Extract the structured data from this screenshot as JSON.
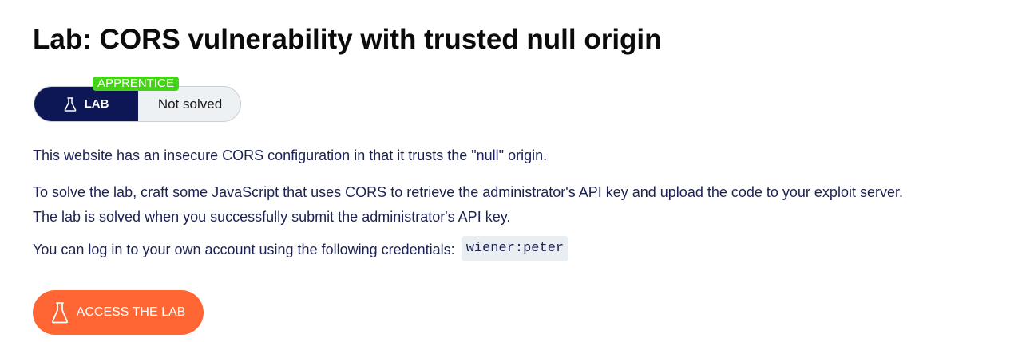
{
  "lab": {
    "title": "Lab: CORS vulnerability with trusted null origin",
    "level": "APPRENTICE",
    "badge_label": "LAB",
    "status": "Not solved",
    "description": {
      "line1": "This website has an insecure CORS configuration in that it trusts the \"null\" origin.",
      "line2a": "To solve the lab, craft some JavaScript that uses CORS to retrieve the administrator's API key and upload the code to your exploit server.",
      "line2b": "The lab is solved when you successfully submit the administrator's API key.",
      "line3": "You can log in to your own account using the following credentials:",
      "credentials": "wiener:peter"
    },
    "access_button": "ACCESS THE LAB"
  },
  "colors": {
    "title": "#0b0b0b",
    "text": "#1c2254",
    "badge_dark": "#0d1756",
    "apprentice_green": "#45d317",
    "access_orange": "#ff6633"
  },
  "icons": {
    "badge_icon": "flask-icon",
    "button_icon": "flask-icon"
  }
}
